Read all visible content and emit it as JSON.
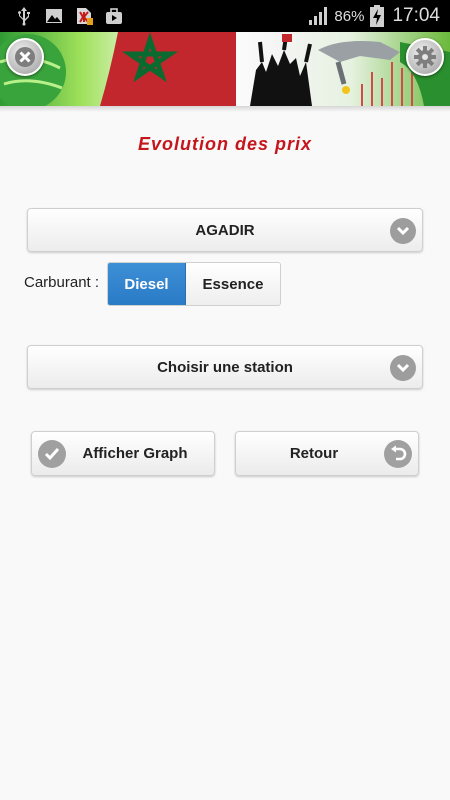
{
  "status_bar": {
    "battery_percent": "86%",
    "time": "17:04",
    "icons": [
      "usb-icon",
      "image-icon",
      "antivirus-icon",
      "briefcase-icon",
      "signal-icon",
      "battery-charging-icon"
    ]
  },
  "header": {
    "close_icon": "close-icon",
    "settings_icon": "gear-icon"
  },
  "page": {
    "title": "Evolution des prix"
  },
  "city_select": {
    "value": "AGADIR"
  },
  "fuel": {
    "label": "Carburant :",
    "options": [
      "Diesel",
      "Essence"
    ],
    "selected": "Diesel"
  },
  "station_select": {
    "value": "Choisir une station"
  },
  "actions": {
    "show_graph_label": "Afficher Graph",
    "back_label": "Retour"
  },
  "colors": {
    "title": "#c4161c",
    "segment_active": "#2a7bc6",
    "status_bar": "#000000"
  }
}
